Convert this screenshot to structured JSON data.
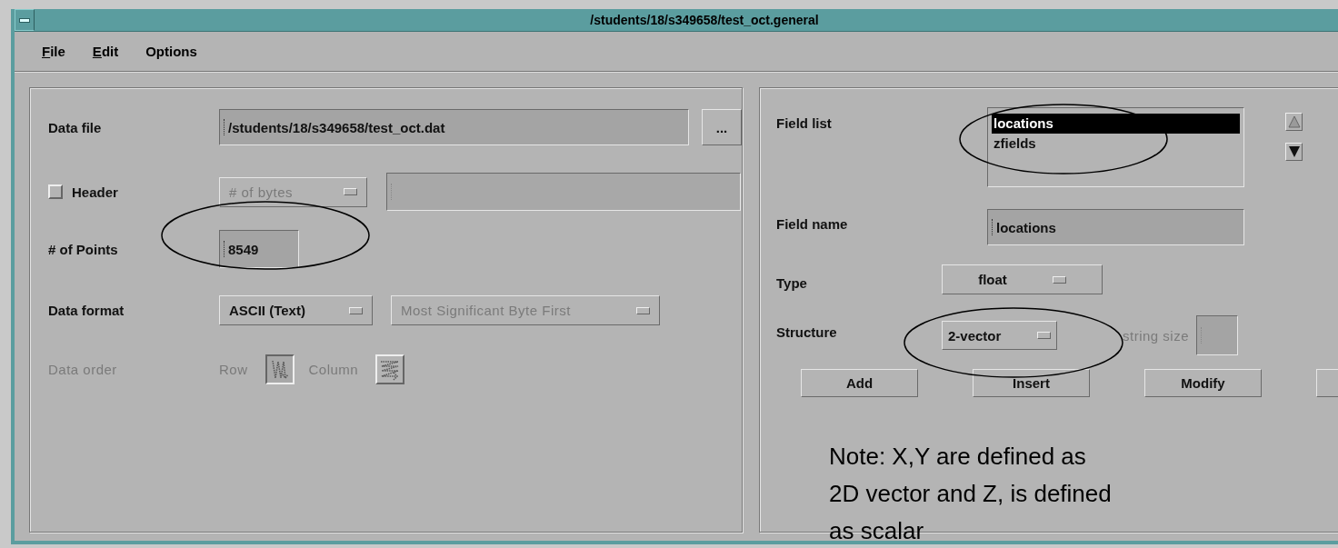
{
  "window": {
    "title": "/students/18/s349658/test_oct.general"
  },
  "menu": [
    {
      "label": "File",
      "underline_first": true
    },
    {
      "label": "Edit",
      "underline_first": true
    },
    {
      "label": "Options",
      "underline_first": false
    }
  ],
  "data_file": {
    "label": "Data file",
    "value": "/students/18/s349658/test_oct.dat",
    "browse": "..."
  },
  "header": {
    "label": "Header",
    "checked": false,
    "size_unit": {
      "value": "# of bytes",
      "disabled": true
    },
    "size_field": {
      "disabled": true
    }
  },
  "points": {
    "label": "# of Points",
    "value": "8549"
  },
  "data_format": {
    "label": "Data format",
    "format": {
      "value": "ASCII (Text)",
      "disabled": false
    },
    "byte_order": {
      "value": "Most Significant Byte First",
      "disabled": true
    }
  },
  "data_order": {
    "label": "Data order",
    "disabled": true,
    "options": [
      {
        "label": "Row",
        "selected": true
      },
      {
        "label": "Column",
        "selected": false
      }
    ]
  },
  "field_list": {
    "label": "Field list",
    "items": [
      {
        "label": "locations",
        "selected": true
      },
      {
        "label": "zfields",
        "selected": false
      }
    ]
  },
  "field_name": {
    "label": "Field name",
    "value": "locations"
  },
  "type": {
    "label": "Type",
    "value": "float"
  },
  "structure": {
    "label": "Structure",
    "value": "2-vector"
  },
  "string_size": {
    "label": "string size",
    "disabled": true
  },
  "buttons": [
    {
      "label": "Add"
    },
    {
      "label": "Insert"
    },
    {
      "label": "Modify"
    }
  ],
  "note": {
    "lines": [
      "Note: X,Y are defined as",
      "2D vector and Z, is defined",
      "as scalar"
    ]
  }
}
